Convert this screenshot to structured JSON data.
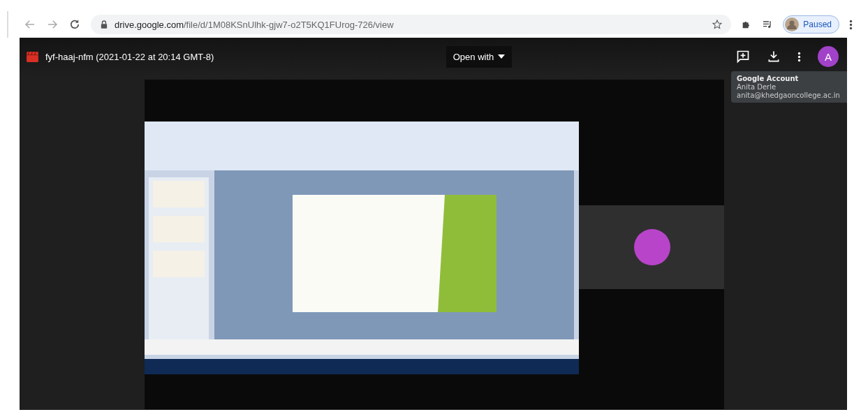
{
  "browser": {
    "url_host": "drive.google.com",
    "url_path": "/file/d/1M08KSnUlhk-gjw7-o2T5KQ1FUrog-726/view",
    "profile_status": "Paused"
  },
  "viewer": {
    "file_title": "fyf-haaj-nfm (2021-01-22 at 20:14 GMT-8)",
    "open_with": "Open with",
    "account_initial": "A"
  },
  "tooltip": {
    "title": "Google Account",
    "name": "Anita Derle",
    "email": "anita@khedgaoncollege.ac.in"
  }
}
